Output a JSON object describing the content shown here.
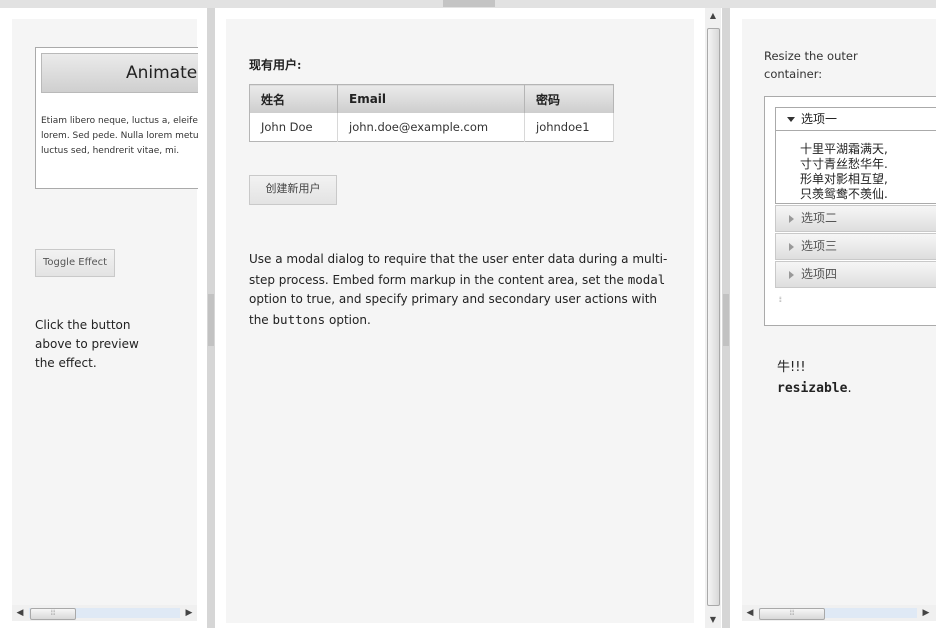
{
  "left_pane": {
    "animate_header": "Animate",
    "animate_body_lines": [
      "Etiam libero neque, luctus a, eleifend",
      "lorem. Sed pede. Nulla lorem metus,",
      "luctus sed, hendrerit vitae, mi."
    ],
    "toggle_button": "Toggle Effect",
    "preview_text_lines": [
      "Click the button",
      "above to preview",
      "the effect."
    ]
  },
  "middle_pane": {
    "section_title": "现有用户:",
    "table": {
      "headers": [
        "姓名",
        "Email",
        "密码"
      ],
      "rows": [
        [
          "John Doe",
          "john.doe@example.com",
          "johndoe1"
        ]
      ]
    },
    "create_user_button": "创建新用户",
    "description": {
      "part1": "Use a modal dialog to require that the user enter data during a multi-step process. Embed form markup in the content area, set the ",
      "code1": "modal",
      "part2": " option to true, and specify primary and secondary user actions with the ",
      "code2": "buttons",
      "part3": " option."
    }
  },
  "right_pane": {
    "resize_label_lines": [
      "Resize the outer",
      "container:"
    ],
    "accordion": {
      "open_section": "选项一",
      "poem_lines": [
        "十里平湖霜满天,",
        "寸寸青丝愁华年.",
        "形单对影相互望,",
        "只羡鸳鸯不羡仙."
      ],
      "collapsed_sections": [
        "选项二",
        "选项三",
        "选项四"
      ]
    },
    "footer_line1": "牛!!!",
    "footer_code": "resizable",
    "footer_end": "."
  },
  "icons": {
    "scroll_left": "◀",
    "scroll_right": "▶",
    "scroll_up": "▲",
    "scroll_down": "▼",
    "grip": "⦙⦙⦙"
  }
}
